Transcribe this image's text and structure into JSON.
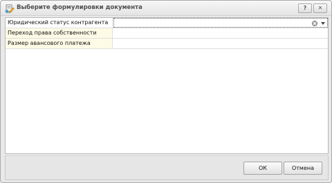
{
  "window": {
    "title": "Выберите формулировки документа",
    "help_label": "?",
    "close_label": "✕"
  },
  "grid": {
    "rows": [
      {
        "label": "Юридический статус контрагента",
        "value": "",
        "selected": true
      },
      {
        "label": "Переход права собственности",
        "value": ""
      },
      {
        "label": "Размер авансового платежа",
        "value": ""
      }
    ]
  },
  "footer": {
    "ok_label": "ОК",
    "cancel_label": "Отмена"
  },
  "icons": {
    "app": "document-edit-icon",
    "clear": "clear-icon",
    "dropdown": "dropdown-arrow-icon"
  }
}
